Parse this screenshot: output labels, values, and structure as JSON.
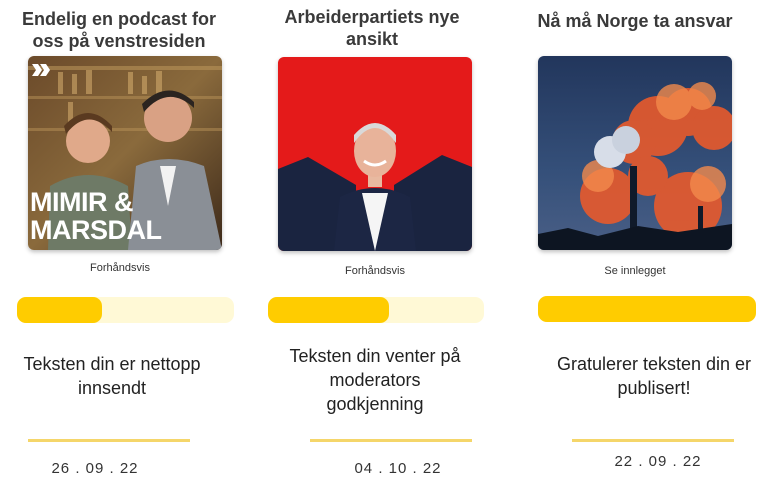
{
  "cards": [
    {
      "title": "Endelig en podcast for oss på venstresiden",
      "image_logo_text": "MIMIR & MARSDAL",
      "link": "Forhåndsvis",
      "progress": 0.39,
      "status": "Teksten din er nettopp innsendt",
      "date": "26 . 09 . 22"
    },
    {
      "title": "Arbeiderpartiets nye ansikt",
      "link": "Forhåndsvis",
      "progress": 0.56,
      "status": "Teksten din venter på moderators godkjenning",
      "date": "04 . 10 . 22"
    },
    {
      "title": "Nå må Norge ta ansvar",
      "link": "Se innlegget",
      "progress": 1.0,
      "status": "Gratulerer teksten din er publisert!",
      "date": "22 . 09 . 22"
    }
  ],
  "colors": {
    "progress_fill": "#ffcc00",
    "progress_track": "#fff9d6",
    "divider": "#f5d66a"
  }
}
